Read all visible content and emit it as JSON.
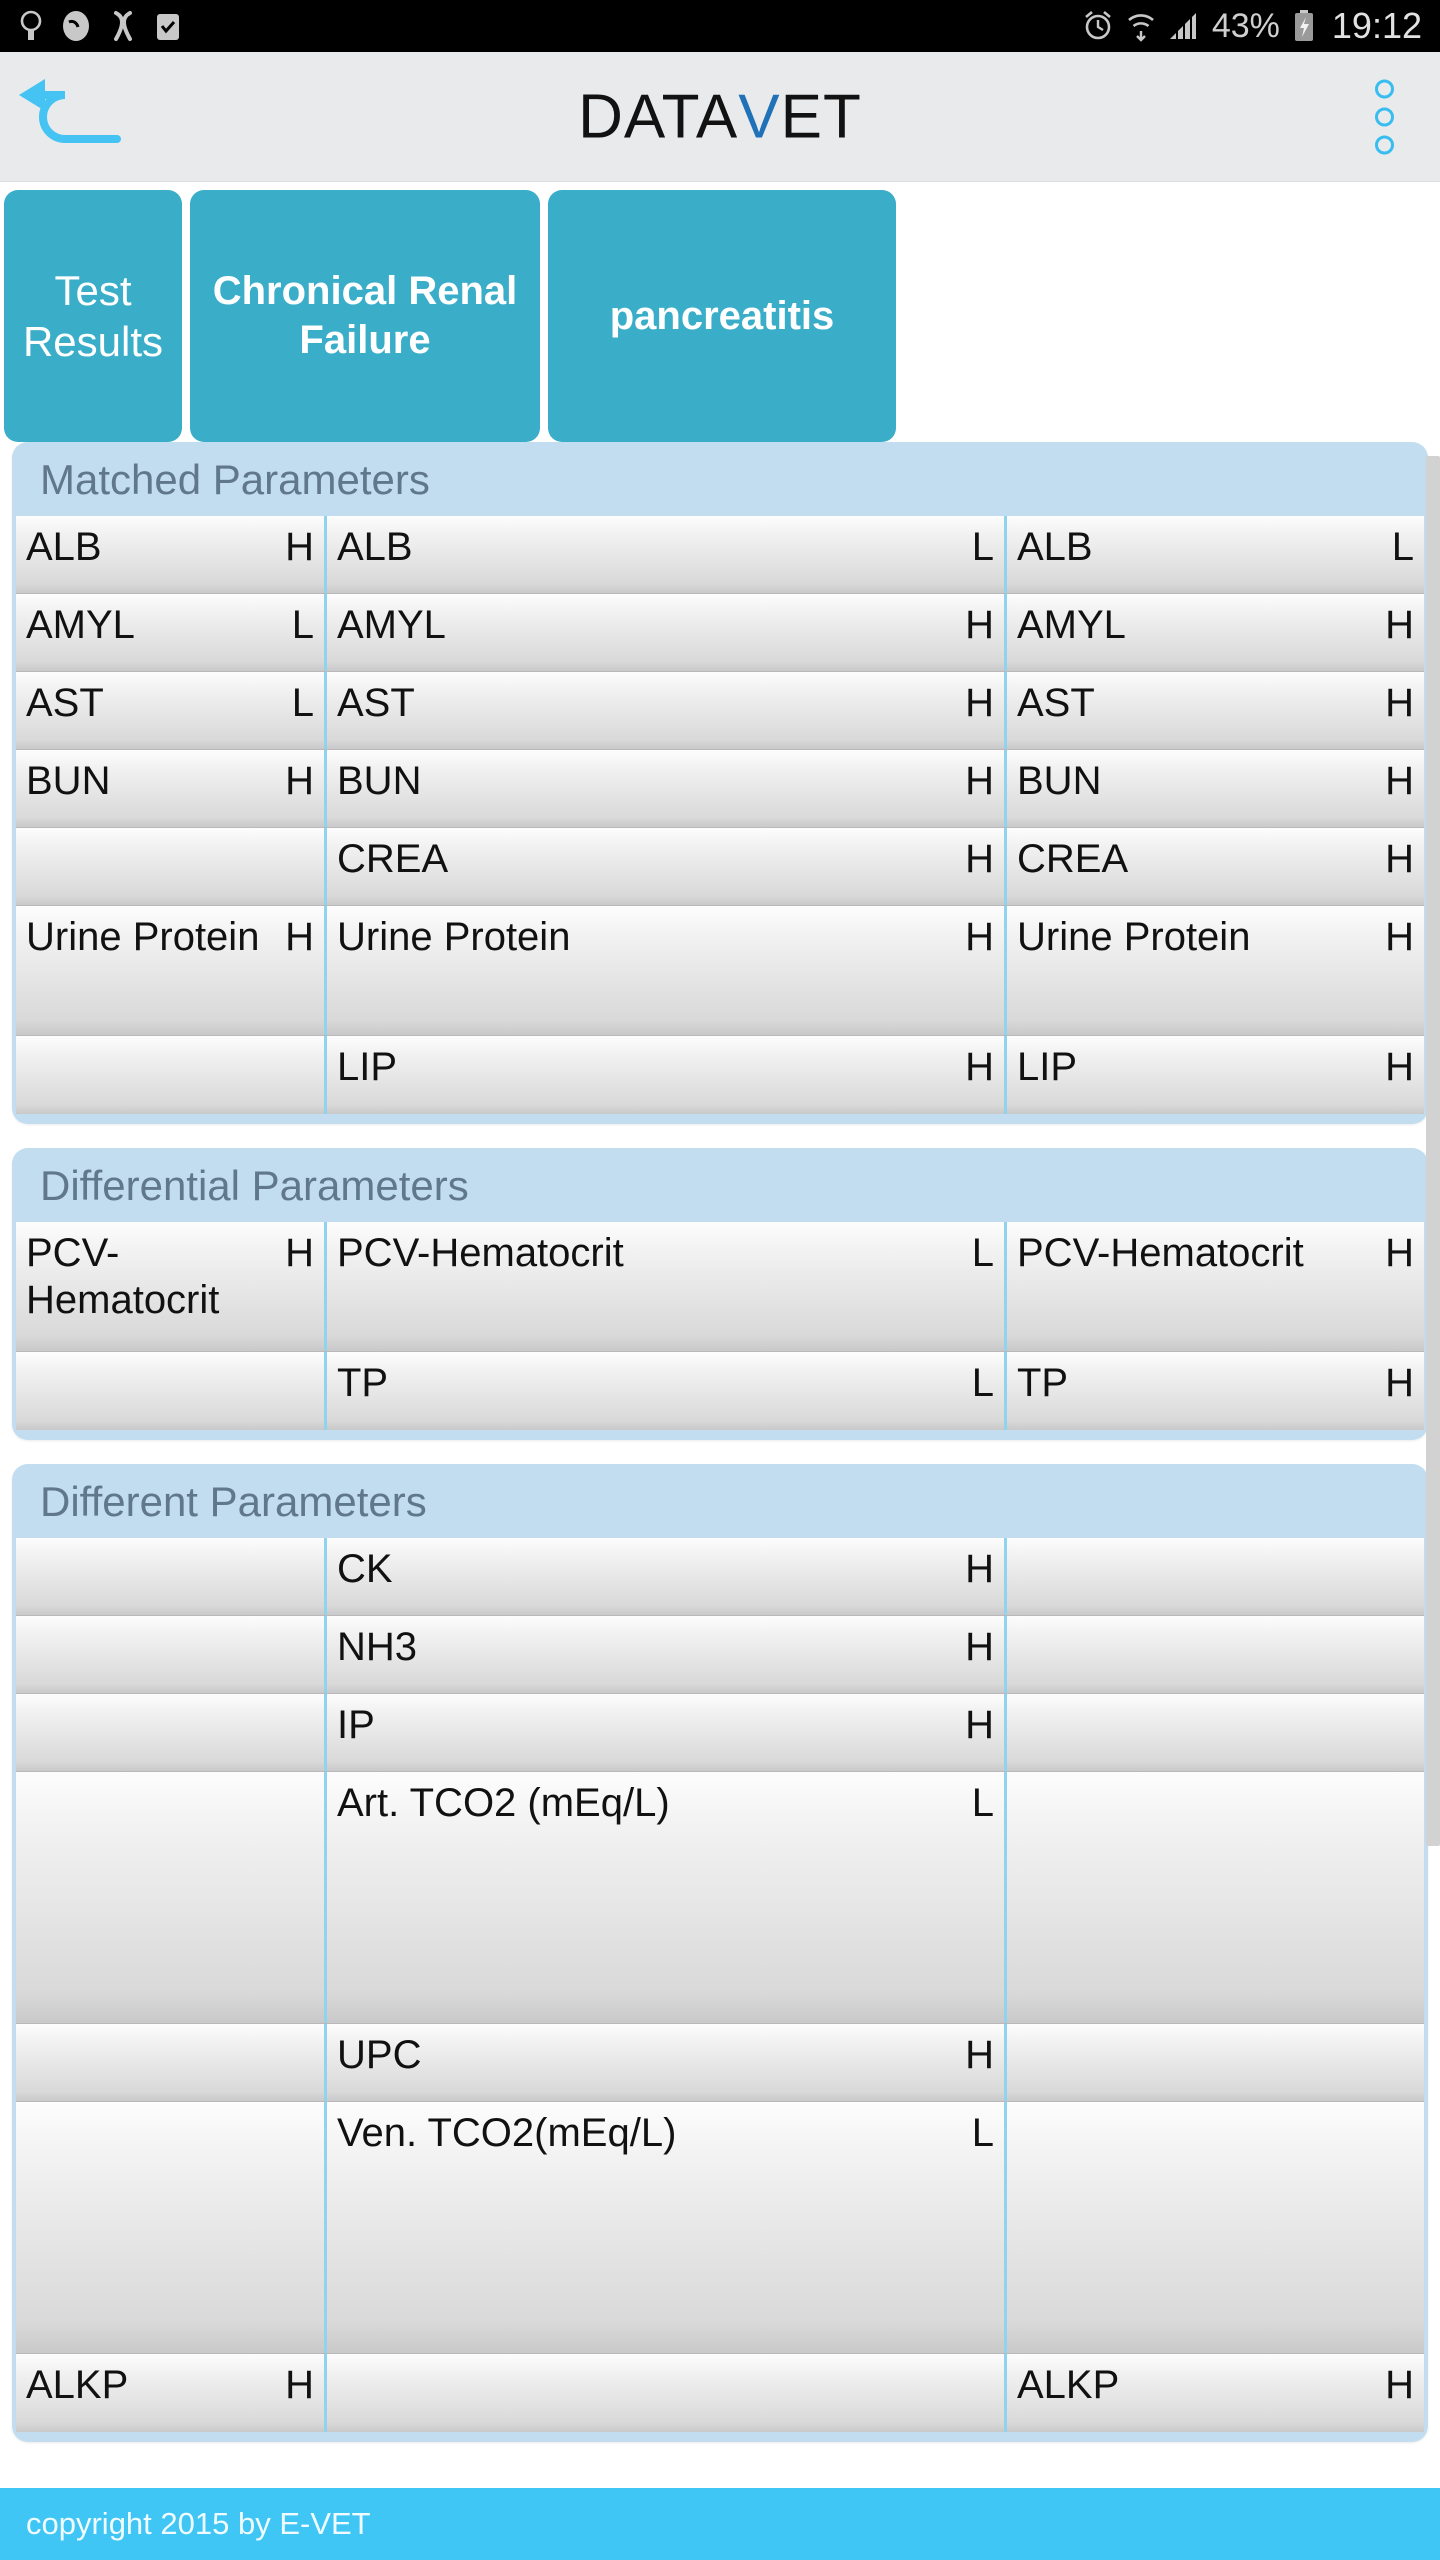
{
  "status_bar": {
    "left_icons": [
      "lightbulb-icon",
      "phone-missed-icon",
      "bluetooth-sharing-icon",
      "checklist-icon"
    ],
    "right_icons": [
      "alarm-icon",
      "wifi-icon",
      "signal-icon"
    ],
    "battery_percent": "43%",
    "battery_icon": "battery-charging-icon",
    "time": "19:12"
  },
  "appbar": {
    "back_icon": "back-arrow-icon",
    "logo_part1": "DATA",
    "logo_part2": "V",
    "logo_part3": "ET",
    "overflow_icon": "more-options-icon",
    "background": "#e9eaec",
    "logo_accent": "#1f72b8"
  },
  "tabs": [
    {
      "label": "Test Results",
      "bold": false
    },
    {
      "label": "Chronical Renal Failure",
      "bold": true
    },
    {
      "label": "pancreatitis",
      "bold": true
    }
  ],
  "tab_color": "#3aaec9",
  "sections": [
    {
      "title": "Matched Parameters",
      "rows": [
        {
          "c1_name": "ALB",
          "c1_flag": "H",
          "c2_name": "ALB",
          "c2_flag": "L",
          "c3_name": "ALB",
          "c3_flag": "L"
        },
        {
          "c1_name": "AMYL",
          "c1_flag": "L",
          "c2_name": "AMYL",
          "c2_flag": "H",
          "c3_name": "AMYL",
          "c3_flag": "H"
        },
        {
          "c1_name": "AST",
          "c1_flag": "L",
          "c2_name": "AST",
          "c2_flag": "H",
          "c3_name": "AST",
          "c3_flag": "H"
        },
        {
          "c1_name": "BUN",
          "c1_flag": "H",
          "c2_name": "BUN",
          "c2_flag": "H",
          "c3_name": "BUN",
          "c3_flag": "H"
        },
        {
          "c1_name": "",
          "c1_flag": "",
          "c2_name": "CREA",
          "c2_flag": "H",
          "c3_name": "CREA",
          "c3_flag": "H"
        },
        {
          "c1_name": "Urine Protein",
          "c1_flag": "H",
          "c2_name": "Urine Protein",
          "c2_flag": "H",
          "c3_name": "Urine Protein",
          "c3_flag": "H"
        },
        {
          "c1_name": "",
          "c1_flag": "",
          "c2_name": "LIP",
          "c2_flag": "H",
          "c3_name": "LIP",
          "c3_flag": "H"
        }
      ]
    },
    {
      "title": "Differential Parameters",
      "rows": [
        {
          "c1_name": "PCV-Hematocrit",
          "c1_flag": "H",
          "c2_name": "PCV-Hematocrit",
          "c2_flag": "L",
          "c3_name": "PCV-Hematocrit",
          "c3_flag": "H"
        },
        {
          "c1_name": "",
          "c1_flag": "",
          "c2_name": "TP",
          "c2_flag": "L",
          "c3_name": "TP",
          "c3_flag": "H"
        }
      ]
    },
    {
      "title": "Different Parameters",
      "rows": [
        {
          "c1_name": "",
          "c1_flag": "",
          "c2_name": "CK",
          "c2_flag": "H",
          "c3_name": "",
          "c3_flag": ""
        },
        {
          "c1_name": "",
          "c1_flag": "",
          "c2_name": "NH3",
          "c2_flag": "H",
          "c3_name": "",
          "c3_flag": ""
        },
        {
          "c1_name": "",
          "c1_flag": "",
          "c2_name": "IP",
          "c2_flag": "H",
          "c3_name": "",
          "c3_flag": ""
        },
        {
          "c1_name": "",
          "c1_flag": "",
          "c2_name": "Art. TCO2 (mEq/L)",
          "c2_flag": "L",
          "c3_name": "",
          "c3_flag": "",
          "tall": true
        },
        {
          "c1_name": "",
          "c1_flag": "",
          "c2_name": "UPC",
          "c2_flag": "H",
          "c3_name": "",
          "c3_flag": ""
        },
        {
          "c1_name": "",
          "c1_flag": "",
          "c2_name": "Ven. TCO2(mEq/L)",
          "c2_flag": "L",
          "c3_name": "",
          "c3_flag": "",
          "tall": true
        },
        {
          "c1_name": "ALKP",
          "c1_flag": "H",
          "c2_name": "",
          "c2_flag": "",
          "c3_name": "ALKP",
          "c3_flag": "H"
        }
      ]
    }
  ],
  "footer": {
    "text": "copyright 2015 by E-VET",
    "background": "#3fc6f5"
  }
}
